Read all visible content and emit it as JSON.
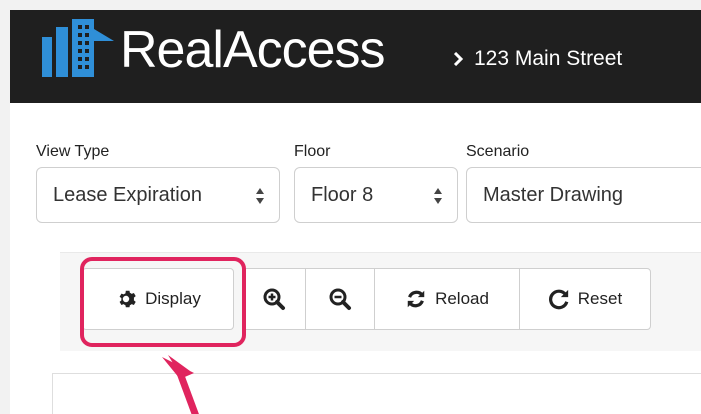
{
  "header": {
    "brand": "RealAccess",
    "breadcrumb": "123 Main Street"
  },
  "filters": {
    "view_type": {
      "label": "View Type",
      "value": "Lease Expiration"
    },
    "floor": {
      "label": "Floor",
      "value": "Floor 8"
    },
    "scenario": {
      "label": "Scenario",
      "value": "Master Drawing"
    }
  },
  "toolbar": {
    "display_label": "Display",
    "reload_label": "Reload",
    "reset_label": "Reset",
    "icons": [
      "gear-icon",
      "zoom-in-icon",
      "zoom-out-icon",
      "refresh-icon",
      "reset-icon"
    ]
  },
  "colors": {
    "header_bg": "#1f1f1f",
    "logo_blue": "#2f8fd8",
    "highlight": "#e0245e"
  }
}
